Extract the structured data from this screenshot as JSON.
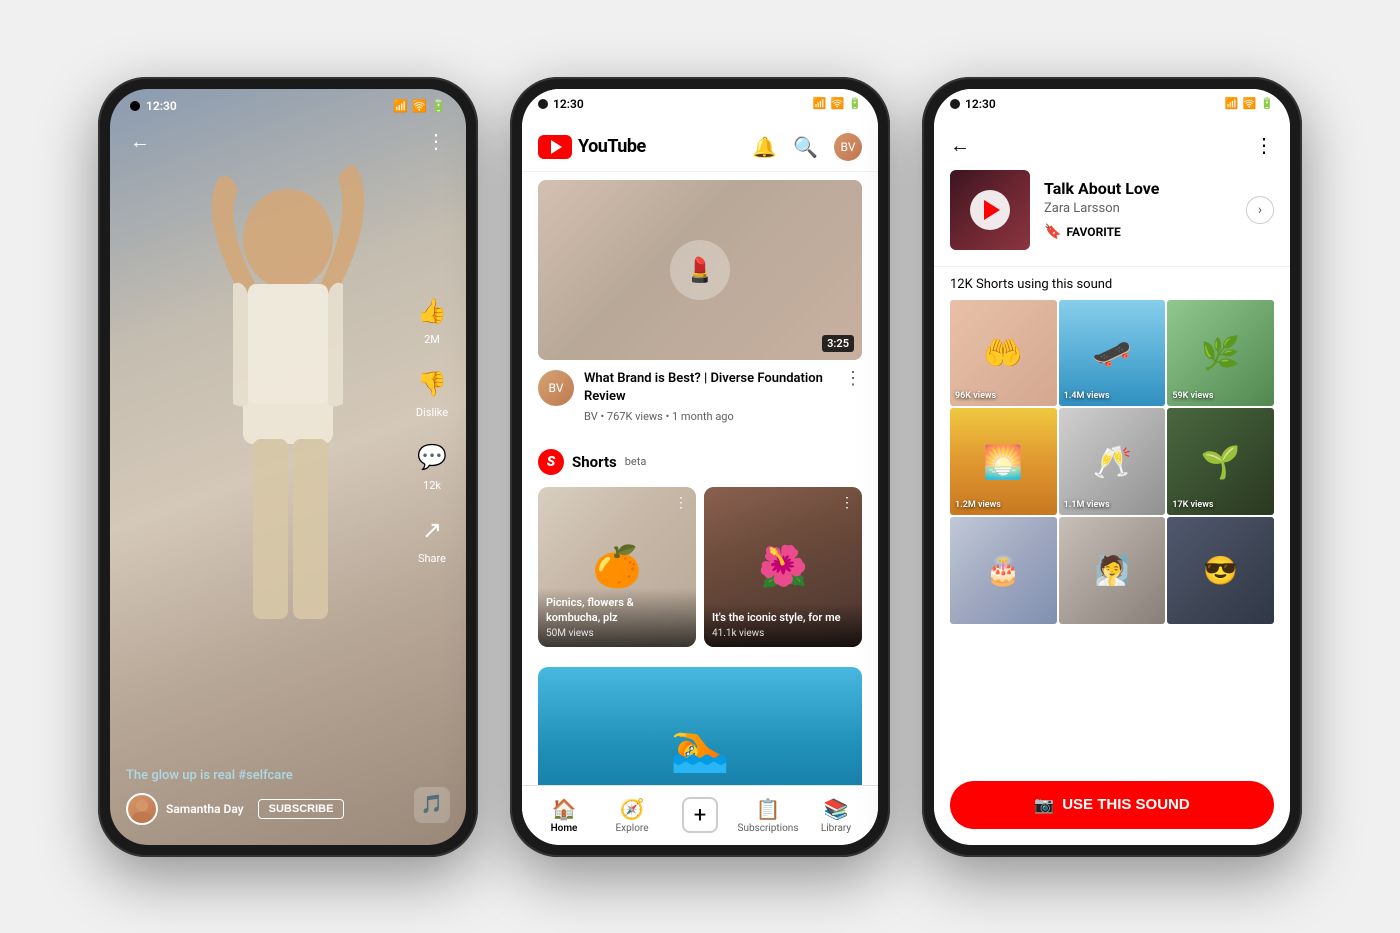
{
  "phones": [
    {
      "id": "phone1",
      "statusBar": {
        "time": "12:30",
        "theme": "dark"
      },
      "content": {
        "type": "shorts_playing",
        "caption": "The glow up is real ",
        "hashtag": "#selfcare",
        "user": "Samantha Day",
        "subscribeBtnLabel": "SUBSCRIBE",
        "actions": [
          {
            "icon": "👍",
            "label": "2M",
            "name": "like"
          },
          {
            "icon": "👎",
            "label": "Dislike",
            "name": "dislike"
          },
          {
            "icon": "💬",
            "label": "12k",
            "name": "comment"
          },
          {
            "icon": "↗",
            "label": "Share",
            "name": "share"
          }
        ]
      }
    },
    {
      "id": "phone2",
      "statusBar": {
        "time": "12:30",
        "theme": "light"
      },
      "content": {
        "type": "youtube_home",
        "logoText": "YouTube",
        "video": {
          "title": "What Brand is Best? | Diverse Foundation Review",
          "channel": "BV",
          "meta": "BV • 767K views • 1 month ago",
          "duration": "3:25"
        },
        "shortsSection": {
          "label": "Shorts",
          "betaLabel": "beta",
          "cards": [
            {
              "title": "Picnics, flowers & kombucha, plz",
              "views": "50M views"
            },
            {
              "title": "It's the iconic style, for me",
              "views": "41.1k views"
            }
          ]
        },
        "bottomNav": [
          {
            "icon": "🏠",
            "label": "Home",
            "active": true
          },
          {
            "icon": "🧭",
            "label": "Explore",
            "active": false
          },
          {
            "icon": "+",
            "label": "",
            "active": false,
            "isAdd": true
          },
          {
            "icon": "📋",
            "label": "Subscriptions",
            "active": false
          },
          {
            "icon": "📚",
            "label": "Library",
            "active": false
          }
        ]
      }
    },
    {
      "id": "phone3",
      "statusBar": {
        "time": "12:30",
        "theme": "light"
      },
      "content": {
        "type": "sound_page",
        "soundTitle": "Talk About Love",
        "soundArtist": "Zara Larsson",
        "favoriteLabel": "FAVORITE",
        "soundCount": "12K Shorts using this sound",
        "videos": [
          {
            "views": "96K views",
            "bg": "svb-1"
          },
          {
            "views": "1.4M views",
            "bg": "svb-2"
          },
          {
            "views": "59K views",
            "bg": "svb-3"
          },
          {
            "views": "1.2M views",
            "bg": "svb-4"
          },
          {
            "views": "1.1M views",
            "bg": "svb-5"
          },
          {
            "views": "17K views",
            "bg": "svb-6"
          },
          {
            "views": "",
            "bg": "svb-7"
          },
          {
            "views": "",
            "bg": "svb-8"
          },
          {
            "views": "",
            "bg": "svb-9"
          }
        ],
        "useSoundBtn": "USE THIS SOUND"
      }
    }
  ]
}
